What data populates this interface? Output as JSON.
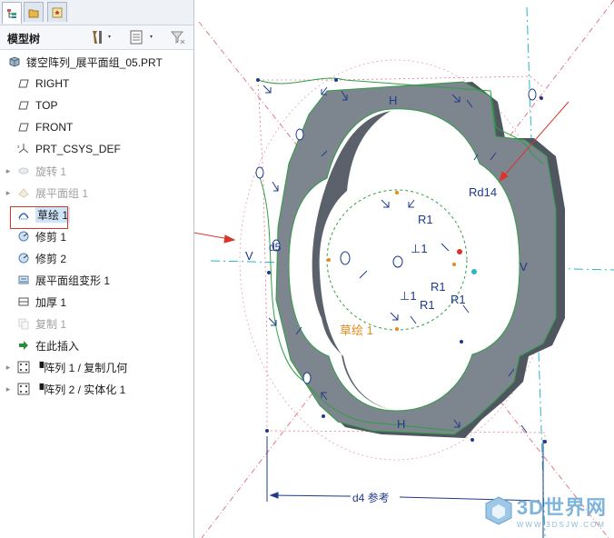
{
  "panel": {
    "title": "模型树",
    "tree": [
      {
        "label": "镂空阵列_展平面组_05.PRT",
        "icon": "part-icon",
        "indent": 0,
        "expander": "",
        "dim": false
      },
      {
        "label": "RIGHT",
        "icon": "datum-plane-icon",
        "indent": 1,
        "expander": "",
        "dim": false
      },
      {
        "label": "TOP",
        "icon": "datum-plane-icon",
        "indent": 1,
        "expander": "",
        "dim": false
      },
      {
        "label": "FRONT",
        "icon": "datum-plane-icon",
        "indent": 1,
        "expander": "",
        "dim": false
      },
      {
        "label": "PRT_CSYS_DEF",
        "icon": "csys-icon",
        "indent": 1,
        "expander": "",
        "dim": false
      },
      {
        "label": "旋转 1",
        "icon": "revolve-icon",
        "indent": 1,
        "expander": "▸",
        "dim": true
      },
      {
        "label": "展平面组 1",
        "icon": "flatten-icon",
        "indent": 1,
        "expander": "▸",
        "dim": true
      },
      {
        "label": "草绘 1",
        "icon": "sketch-icon",
        "indent": 1,
        "expander": "",
        "dim": false
      },
      {
        "label": "修剪 1",
        "icon": "trim-icon",
        "indent": 1,
        "expander": "",
        "dim": false
      },
      {
        "label": "修剪 2",
        "icon": "trim-icon",
        "indent": 1,
        "expander": "",
        "dim": false
      },
      {
        "label": "展平面组变形 1",
        "icon": "flatten-deform-icon",
        "indent": 1,
        "expander": "",
        "dim": false
      },
      {
        "label": "加厚 1",
        "icon": "thicken-icon",
        "indent": 1,
        "expander": "",
        "dim": false
      },
      {
        "label": "复制 1",
        "icon": "copy-icon",
        "indent": 1,
        "expander": "",
        "dim": true
      },
      {
        "label": "在此插入",
        "icon": "insert-arrow-icon",
        "indent": 1,
        "expander": "",
        "dim": false
      },
      {
        "label": "▝阵列 1 / 复制几何",
        "icon": "pattern-icon",
        "indent": 1,
        "expander": "▸",
        "dim": false
      },
      {
        "label": "▝阵列 2 / 实体化 1",
        "icon": "pattern-icon",
        "indent": 1,
        "expander": "▸",
        "dim": false
      }
    ]
  },
  "viewport": {
    "labels": {
      "h_top": "H",
      "h_bottom": "H",
      "v_left": "V",
      "v_right": "V",
      "rd14": "Rd14",
      "r1_a": "R1",
      "r1_b": "R1",
      "r1_c": "R1",
      "r1_d": "R1",
      "perp1_a": "⊥1",
      "perp1_b": "⊥1",
      "d5": "d5",
      "sketch_tag": "草绘 1",
      "d4": "d4 参考"
    },
    "colors": {
      "solid": "#7d858f",
      "solid_dark": "#4f5660",
      "sketch": "#2f9e44",
      "constraint": "#1f3a8a",
      "axis": "#29b6c8",
      "datum": "#e07a8a",
      "annotation": "#d9362b",
      "tag": "#e88a1a"
    }
  },
  "watermark": {
    "brand": "3D世界网",
    "url": "WWW.3DSJW.COM"
  }
}
